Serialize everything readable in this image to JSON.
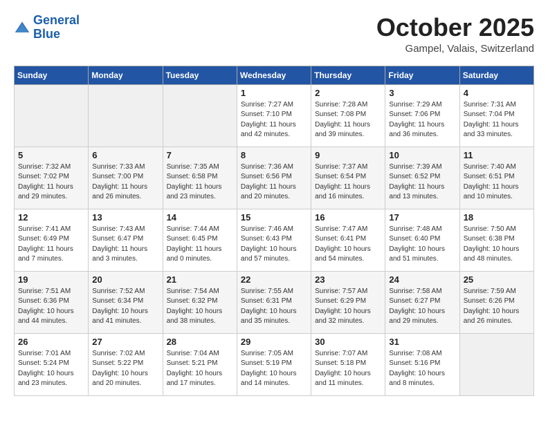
{
  "header": {
    "logo_line1": "General",
    "logo_line2": "Blue",
    "month": "October 2025",
    "location": "Gampel, Valais, Switzerland"
  },
  "days_of_week": [
    "Sunday",
    "Monday",
    "Tuesday",
    "Wednesday",
    "Thursday",
    "Friday",
    "Saturday"
  ],
  "weeks": [
    [
      {
        "day": "",
        "info": ""
      },
      {
        "day": "",
        "info": ""
      },
      {
        "day": "",
        "info": ""
      },
      {
        "day": "1",
        "info": "Sunrise: 7:27 AM\nSunset: 7:10 PM\nDaylight: 11 hours and 42 minutes."
      },
      {
        "day": "2",
        "info": "Sunrise: 7:28 AM\nSunset: 7:08 PM\nDaylight: 11 hours and 39 minutes."
      },
      {
        "day": "3",
        "info": "Sunrise: 7:29 AM\nSunset: 7:06 PM\nDaylight: 11 hours and 36 minutes."
      },
      {
        "day": "4",
        "info": "Sunrise: 7:31 AM\nSunset: 7:04 PM\nDaylight: 11 hours and 33 minutes."
      }
    ],
    [
      {
        "day": "5",
        "info": "Sunrise: 7:32 AM\nSunset: 7:02 PM\nDaylight: 11 hours and 29 minutes."
      },
      {
        "day": "6",
        "info": "Sunrise: 7:33 AM\nSunset: 7:00 PM\nDaylight: 11 hours and 26 minutes."
      },
      {
        "day": "7",
        "info": "Sunrise: 7:35 AM\nSunset: 6:58 PM\nDaylight: 11 hours and 23 minutes."
      },
      {
        "day": "8",
        "info": "Sunrise: 7:36 AM\nSunset: 6:56 PM\nDaylight: 11 hours and 20 minutes."
      },
      {
        "day": "9",
        "info": "Sunrise: 7:37 AM\nSunset: 6:54 PM\nDaylight: 11 hours and 16 minutes."
      },
      {
        "day": "10",
        "info": "Sunrise: 7:39 AM\nSunset: 6:52 PM\nDaylight: 11 hours and 13 minutes."
      },
      {
        "day": "11",
        "info": "Sunrise: 7:40 AM\nSunset: 6:51 PM\nDaylight: 11 hours and 10 minutes."
      }
    ],
    [
      {
        "day": "12",
        "info": "Sunrise: 7:41 AM\nSunset: 6:49 PM\nDaylight: 11 hours and 7 minutes."
      },
      {
        "day": "13",
        "info": "Sunrise: 7:43 AM\nSunset: 6:47 PM\nDaylight: 11 hours and 3 minutes."
      },
      {
        "day": "14",
        "info": "Sunrise: 7:44 AM\nSunset: 6:45 PM\nDaylight: 11 hours and 0 minutes."
      },
      {
        "day": "15",
        "info": "Sunrise: 7:46 AM\nSunset: 6:43 PM\nDaylight: 10 hours and 57 minutes."
      },
      {
        "day": "16",
        "info": "Sunrise: 7:47 AM\nSunset: 6:41 PM\nDaylight: 10 hours and 54 minutes."
      },
      {
        "day": "17",
        "info": "Sunrise: 7:48 AM\nSunset: 6:40 PM\nDaylight: 10 hours and 51 minutes."
      },
      {
        "day": "18",
        "info": "Sunrise: 7:50 AM\nSunset: 6:38 PM\nDaylight: 10 hours and 48 minutes."
      }
    ],
    [
      {
        "day": "19",
        "info": "Sunrise: 7:51 AM\nSunset: 6:36 PM\nDaylight: 10 hours and 44 minutes."
      },
      {
        "day": "20",
        "info": "Sunrise: 7:52 AM\nSunset: 6:34 PM\nDaylight: 10 hours and 41 minutes."
      },
      {
        "day": "21",
        "info": "Sunrise: 7:54 AM\nSunset: 6:32 PM\nDaylight: 10 hours and 38 minutes."
      },
      {
        "day": "22",
        "info": "Sunrise: 7:55 AM\nSunset: 6:31 PM\nDaylight: 10 hours and 35 minutes."
      },
      {
        "day": "23",
        "info": "Sunrise: 7:57 AM\nSunset: 6:29 PM\nDaylight: 10 hours and 32 minutes."
      },
      {
        "day": "24",
        "info": "Sunrise: 7:58 AM\nSunset: 6:27 PM\nDaylight: 10 hours and 29 minutes."
      },
      {
        "day": "25",
        "info": "Sunrise: 7:59 AM\nSunset: 6:26 PM\nDaylight: 10 hours and 26 minutes."
      }
    ],
    [
      {
        "day": "26",
        "info": "Sunrise: 7:01 AM\nSunset: 5:24 PM\nDaylight: 10 hours and 23 minutes."
      },
      {
        "day": "27",
        "info": "Sunrise: 7:02 AM\nSunset: 5:22 PM\nDaylight: 10 hours and 20 minutes."
      },
      {
        "day": "28",
        "info": "Sunrise: 7:04 AM\nSunset: 5:21 PM\nDaylight: 10 hours and 17 minutes."
      },
      {
        "day": "29",
        "info": "Sunrise: 7:05 AM\nSunset: 5:19 PM\nDaylight: 10 hours and 14 minutes."
      },
      {
        "day": "30",
        "info": "Sunrise: 7:07 AM\nSunset: 5:18 PM\nDaylight: 10 hours and 11 minutes."
      },
      {
        "day": "31",
        "info": "Sunrise: 7:08 AM\nSunset: 5:16 PM\nDaylight: 10 hours and 8 minutes."
      },
      {
        "day": "",
        "info": ""
      }
    ]
  ]
}
